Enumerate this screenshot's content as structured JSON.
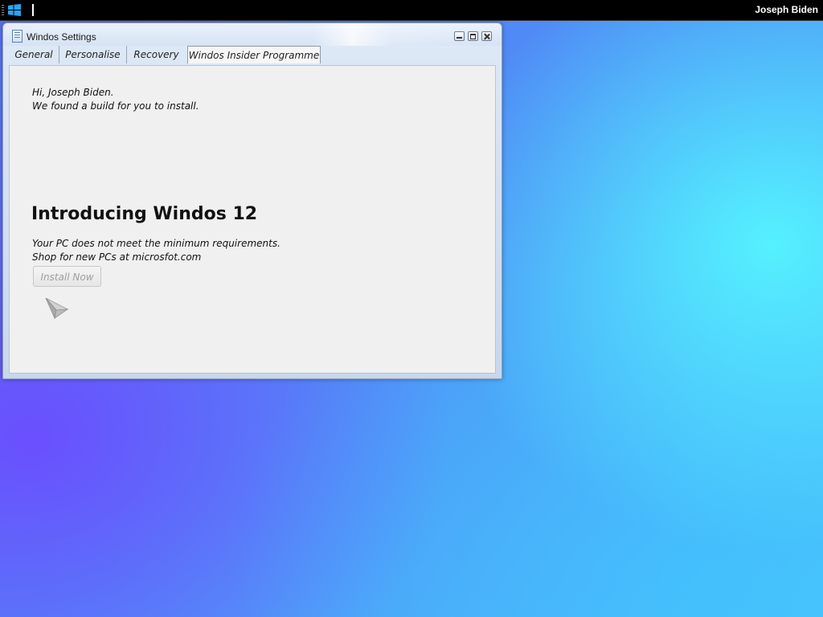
{
  "topbar": {
    "start_icon": "windows-logo-icon",
    "user_name": "Joseph Biden"
  },
  "window": {
    "title": "Windos Settings",
    "app_icon": "settings-document-icon",
    "controls": [
      "minimize-icon",
      "maximize-icon",
      "close-icon"
    ]
  },
  "tabs": [
    {
      "label": "General"
    },
    {
      "label": "Personalise"
    },
    {
      "label": "Recovery"
    },
    {
      "label": "Windos Insider Programme",
      "selected": true
    }
  ],
  "content": {
    "greeting_line1": "Hi, Joseph Biden.",
    "greeting_line2": "We found a build for you to install.",
    "headline": "Introducing Windos 12",
    "requirement_line1": "Your PC does not meet the minimum requirements.",
    "requirement_line2": "Shop for new PCs at microsfot.com",
    "install_button": "Install Now",
    "install_button_enabled": false,
    "illustration_icon": "paper-plane-icon"
  },
  "colors": {
    "desktop_cyan": "#55f5ff",
    "desktop_blue": "#4f8ff6",
    "desktop_violet": "#6e46ff",
    "taskbar": "#000000",
    "content_bg": "#f0f0f0"
  }
}
